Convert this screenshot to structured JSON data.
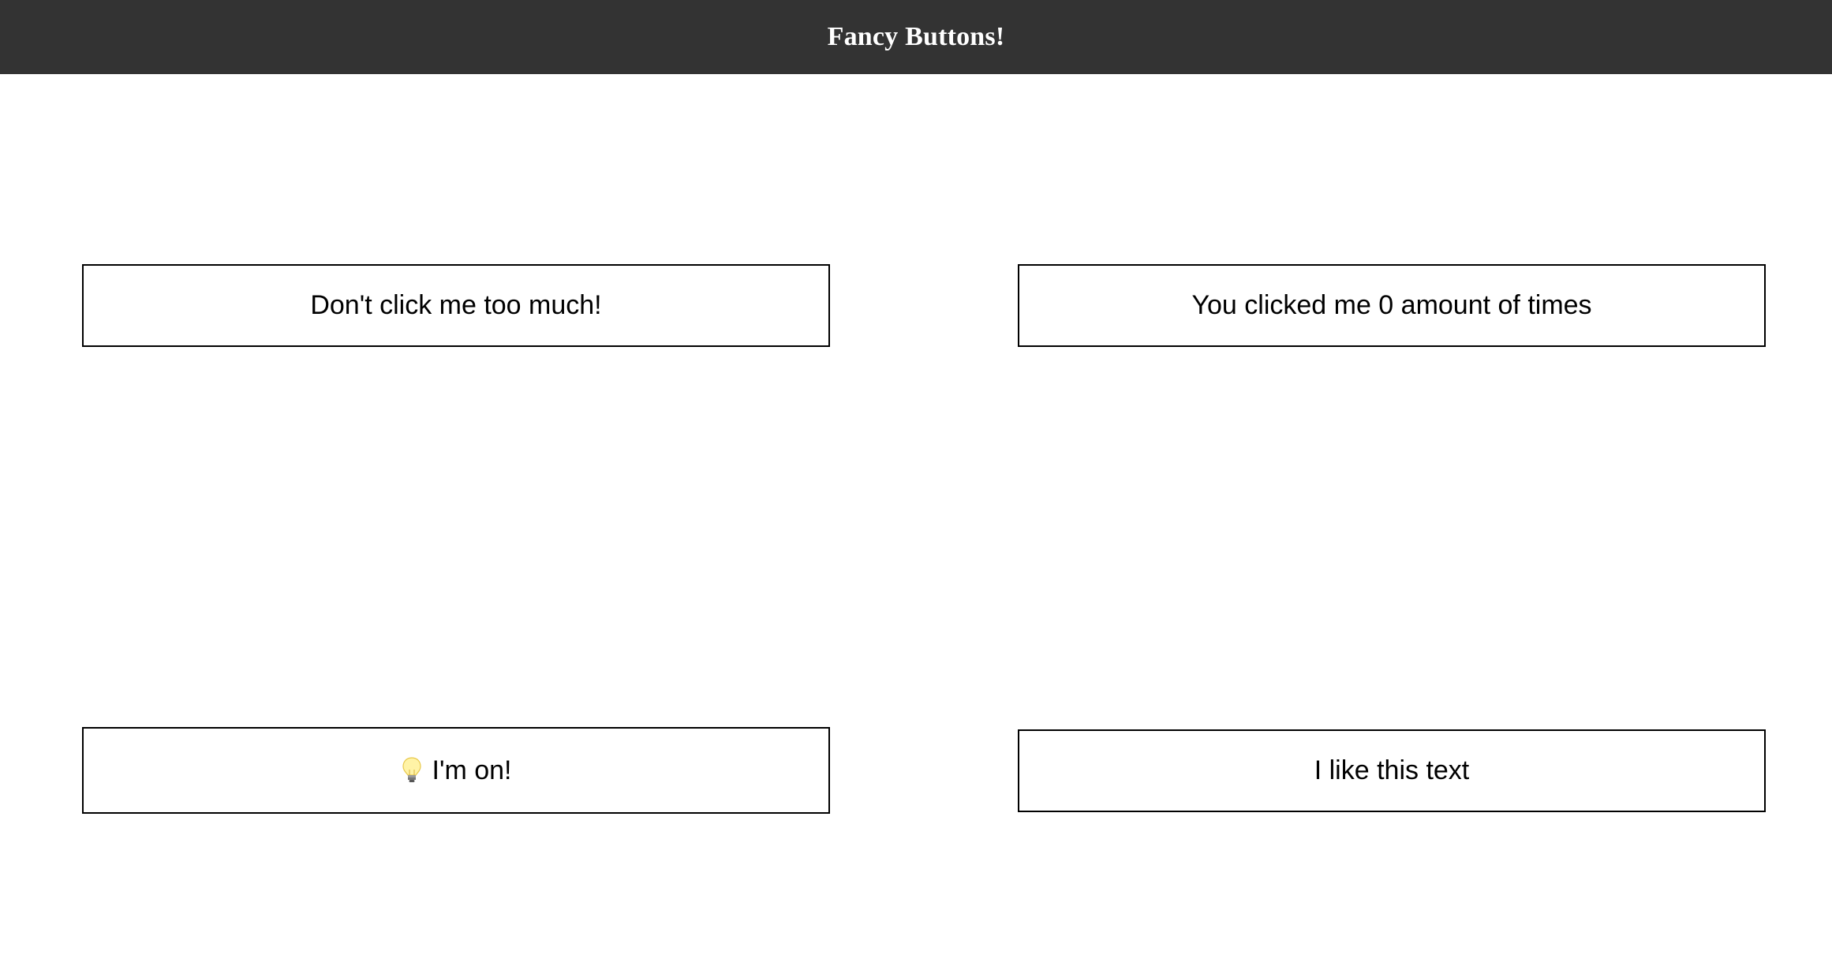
{
  "header": {
    "title": "Fancy Buttons!"
  },
  "buttons": [
    {
      "label": "Don't click me too much!"
    },
    {
      "label": "You clicked me 0 amount of times"
    },
    {
      "label": "I'm on!",
      "icon": "lightbulb-icon"
    },
    {
      "label": "I like this text"
    }
  ],
  "colors": {
    "header_bg": "#333333",
    "header_text": "#ffffff",
    "button_border": "#000000",
    "bulb_fill": "#fff3a6",
    "bulb_base": "#777777"
  }
}
